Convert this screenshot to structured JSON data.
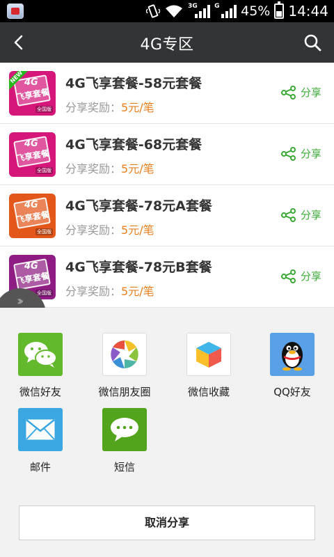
{
  "status_bar": {
    "network_3g": "3G",
    "network_g": "G",
    "battery_percent": "45%",
    "time": "14:44"
  },
  "header": {
    "title": "4G专区",
    "back_icon": "back-arrow-icon",
    "search_icon": "search-icon"
  },
  "packages": [
    {
      "title": "4G飞享套餐-58元套餐",
      "reward_label": "分享奖励：",
      "reward_value": "5元/笔",
      "share_label": "分享",
      "thumb_color": "#d6177a",
      "thumb_text": "飞享套餐",
      "thumb_4g": "4G",
      "thumb_national": "全国版",
      "new_badge": "NEW"
    },
    {
      "title": "4G飞享套餐-68元套餐",
      "reward_label": "分享奖励：",
      "reward_value": "5元/笔",
      "share_label": "分享",
      "thumb_color": "#d6177a",
      "thumb_text": "飞享套餐",
      "thumb_4g": "4G",
      "thumb_national": "全国版"
    },
    {
      "title": "4G飞享套餐-78元A套餐",
      "reward_label": "分享奖励：",
      "reward_value": "5元/笔",
      "share_label": "分享",
      "thumb_color": "#e4571a",
      "thumb_text": "飞享套餐",
      "thumb_4g": "4G",
      "thumb_national": "全国版"
    },
    {
      "title": "4G飞享套餐-78元B套餐",
      "reward_label": "分享奖励：",
      "reward_value": "5元/笔",
      "share_label": "分享",
      "thumb_color": "#8e1c83",
      "thumb_text": "飞享套餐",
      "thumb_4g": "4G",
      "thumb_national": "全国版"
    }
  ],
  "share_sheet": {
    "targets": [
      {
        "label": "微信好友",
        "icon": "wechat-icon",
        "color": "#63b92c"
      },
      {
        "label": "微信朋友圈",
        "icon": "moments-icon",
        "color": "#ffffff"
      },
      {
        "label": "微信收藏",
        "icon": "favorites-cube-icon",
        "color": "#ffffff"
      },
      {
        "label": "QQ好友",
        "icon": "qq-penguin-icon",
        "color": "#5aa0e6"
      },
      {
        "label": "邮件",
        "icon": "mail-icon",
        "color": "#3aa6e2"
      },
      {
        "label": "短信",
        "icon": "sms-icon",
        "color": "#52a41c"
      }
    ],
    "cancel_label": "取消分享"
  },
  "colors": {
    "header_bg": "#333436",
    "accent_green": "#3aaa35",
    "reward_orange": "#e8801e"
  }
}
